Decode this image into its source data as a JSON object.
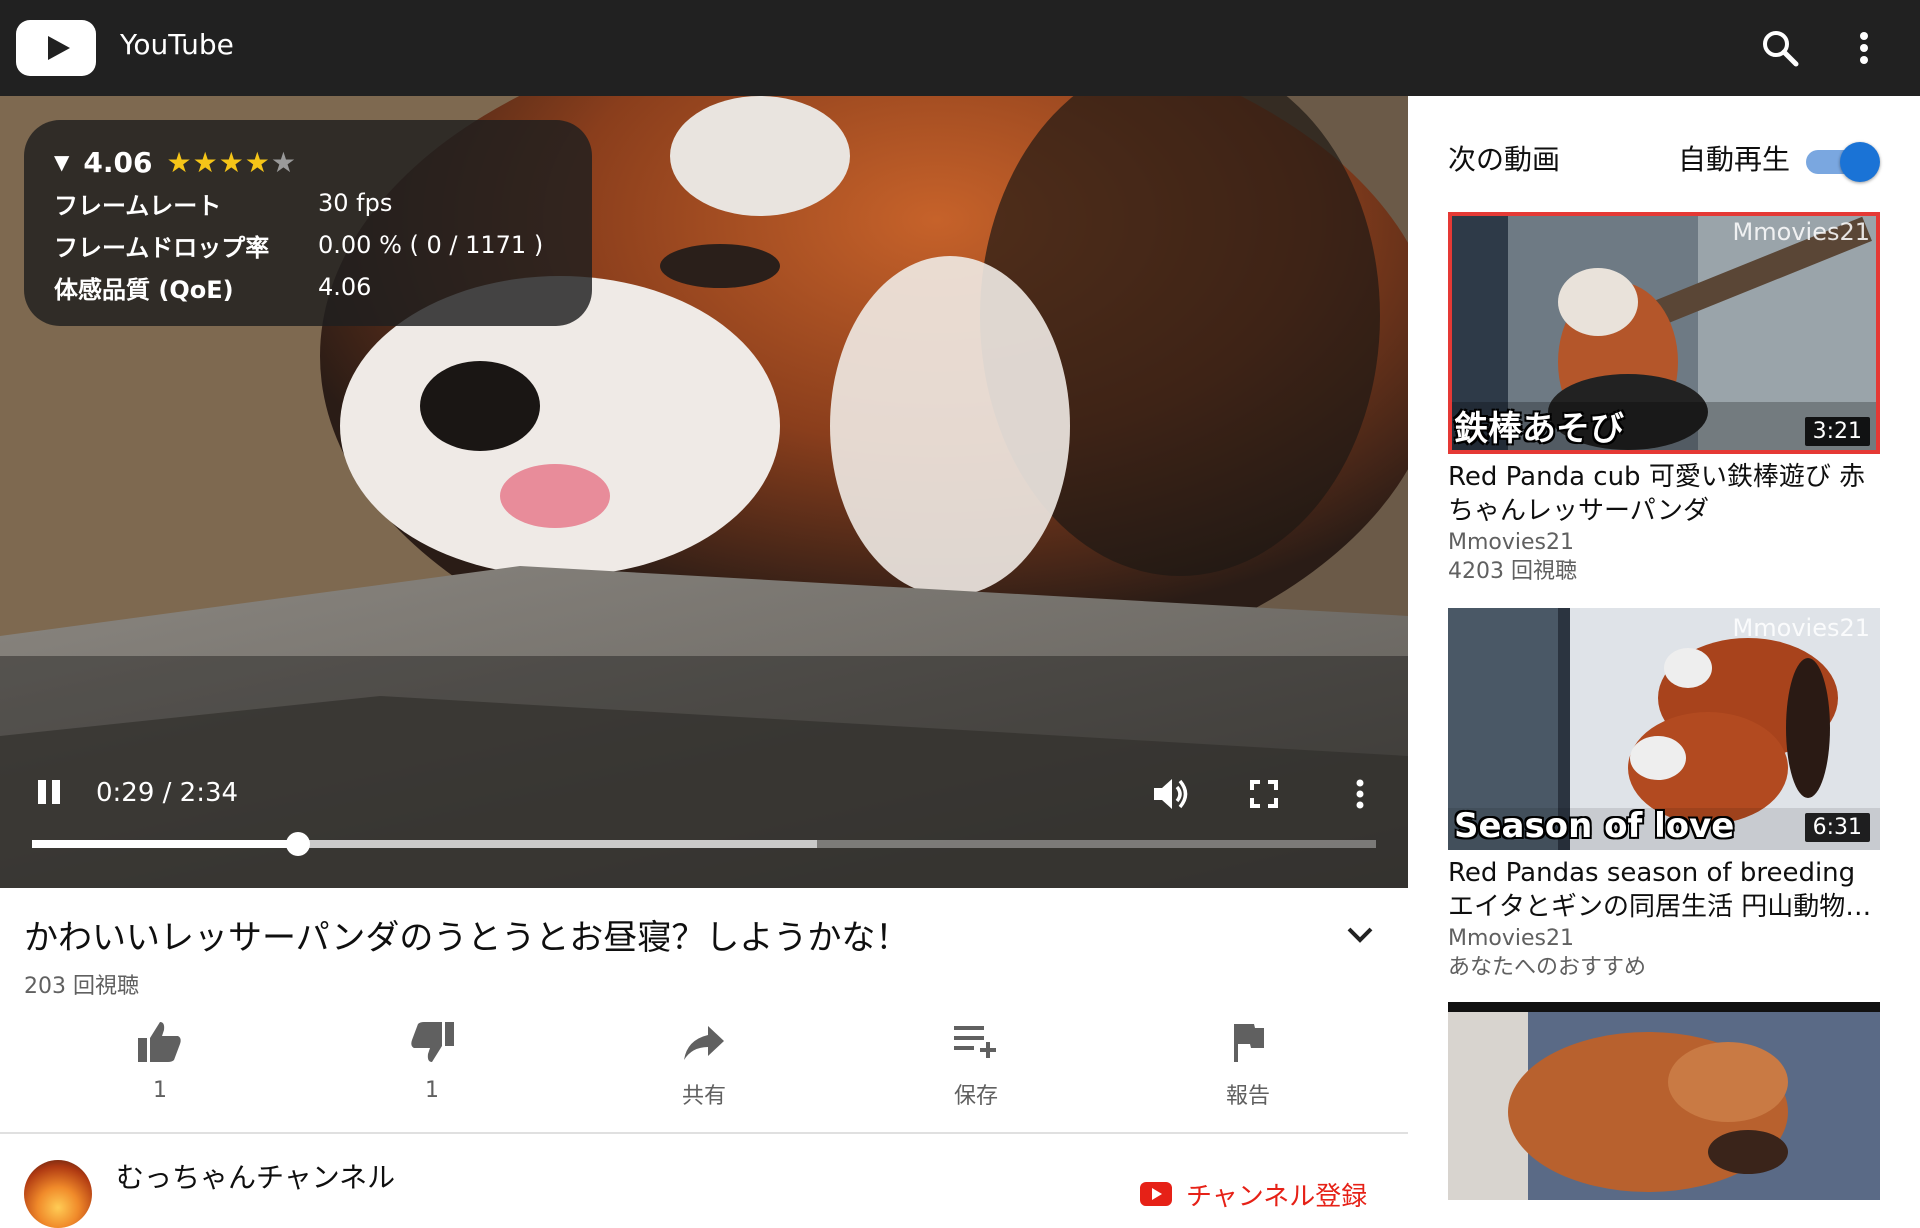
{
  "app": {
    "title": "YouTube"
  },
  "player": {
    "qoe": {
      "score": "4.06",
      "rows": [
        {
          "label": "フレームレート",
          "value": "30 fps"
        },
        {
          "label": "フレームドロップ率",
          "value": "0.00 % ( 0 / 1171 )"
        },
        {
          "label": "体感品質 (QoE)",
          "value": "4.06"
        }
      ],
      "stars_filled": 4,
      "stars_total": 5
    },
    "time": "0:29 / 2:34",
    "progress": {
      "played_fraction": 0.198,
      "buffered_fraction": 0.584
    }
  },
  "video": {
    "title": "かわいいレッサーパンダのうとうとお昼寝？しようかな！",
    "views": "203 回視聴",
    "actions": [
      {
        "name": "like",
        "label": "1"
      },
      {
        "name": "dislike",
        "label": "1"
      },
      {
        "name": "share",
        "label": "共有"
      },
      {
        "name": "save",
        "label": "保存"
      },
      {
        "name": "report",
        "label": "報告"
      }
    ],
    "channel": {
      "name": "むっちゃんチャンネル",
      "subscribe_label": "チャンネル登録"
    }
  },
  "sidebar": {
    "up_next_label": "次の動画",
    "autoplay_label": "自動再生",
    "autoplay_on": true,
    "items": [
      {
        "watermark": "Mmovies21",
        "overlay": "鉄棒あそび",
        "duration": "3:21",
        "title": "Red Panda cub 可愛い鉄棒遊び 赤ちゃんレッサーパンダ",
        "channel": "Mmovies21",
        "meta": "4203 回視聴"
      },
      {
        "watermark": "Mmovies21",
        "overlay": "Season of love",
        "duration": "6:31",
        "title": "Red Pandas season of breeding エイタとギンの同居生活 円山動物…",
        "channel": "Mmovies21",
        "meta": "あなたへのおすすめ"
      },
      {
        "watermark": "",
        "overlay": "",
        "duration": "",
        "title": "",
        "channel": "",
        "meta": ""
      }
    ]
  },
  "colors": {
    "topbar": "#212121",
    "accent_red": "#e62117",
    "toggle_blue": "#1a73d6",
    "star": "#f5c518"
  }
}
